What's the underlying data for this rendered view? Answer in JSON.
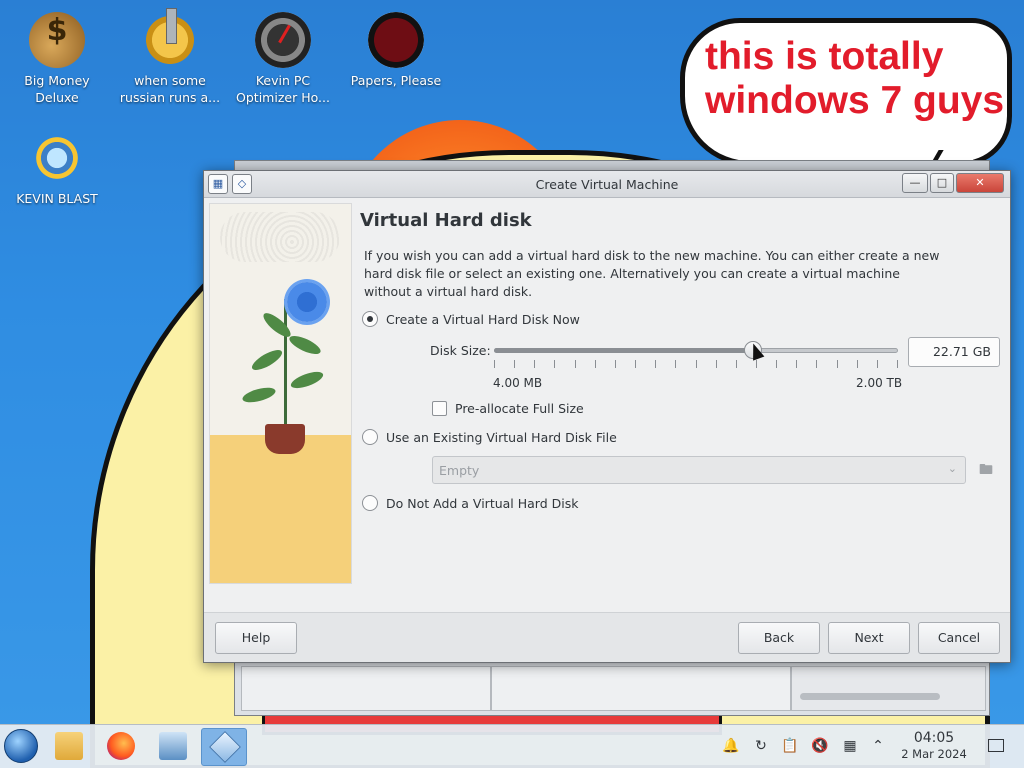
{
  "desktop": {
    "icons": [
      {
        "label": "Big Money\nDeluxe",
        "icon": "money-bag-icon"
      },
      {
        "label": "when some\nrussian runs a...",
        "icon": "gear-lever-icon"
      },
      {
        "label": "Kevin PC\nOptimizer Ho...",
        "icon": "speedometer-icon"
      },
      {
        "label": "Papers, Please",
        "icon": "eagle-emblem-icon"
      },
      {
        "label": "KEVIN BLAST",
        "icon": "globe-sun-icon"
      }
    ],
    "speech_bubble": "this is totally windows 7 guys",
    "speech_color": "#e21c2b"
  },
  "dialog": {
    "title": "Create Virtual Machine",
    "heading": "Virtual Hard disk",
    "description": "If you wish you can add a virtual hard disk to the new machine. You can either create a new hard disk file or select an existing one. Alternatively you can create a virtual machine without a virtual hard disk.",
    "options": {
      "create_now": {
        "label": "Create a Virtual Hard Disk Now",
        "selected": true
      },
      "use_existing": {
        "label": "Use an Existing Virtual Hard Disk File",
        "selected": false
      },
      "do_not_add": {
        "label": "Do Not Add a Virtual Hard Disk",
        "selected": false
      }
    },
    "disk_size": {
      "label": "Disk Size:",
      "value": "22.71 GB",
      "min_label": "4.00 MB",
      "max_label": "2.00 TB",
      "slider_fraction": 0.64,
      "tick_count": 20
    },
    "preallocate": {
      "label": "Pre-allocate Full Size",
      "checked": false
    },
    "existing_file_combo": {
      "value": "Empty"
    },
    "buttons": {
      "help": "Help",
      "back": "Back",
      "next": "Next",
      "cancel": "Cancel"
    },
    "window_controls": {
      "minimize": "—",
      "maximize": "□",
      "close": "✕"
    }
  },
  "taskbar": {
    "time": "04:05",
    "date": "2 Mar 2024",
    "pinned": [
      "file-manager-icon",
      "firefox-icon",
      "system-settings-icon",
      "virtualbox-icon"
    ],
    "tray": [
      "notifications-bell-icon",
      "updates-icon",
      "clipboard-icon",
      "volume-muted-icon",
      "input-method-icon",
      "show-hidden-chevron-icon",
      "show-desktop-icon"
    ]
  }
}
